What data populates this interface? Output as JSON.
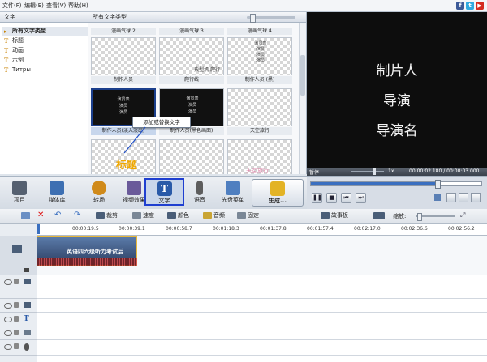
{
  "menu": [
    "文件(F)",
    "编辑(E)",
    "查看(V)",
    "帮助(H)"
  ],
  "social": [
    {
      "icon": "facebook-icon",
      "letter": "f",
      "color": "#3b5998"
    },
    {
      "icon": "twitter-icon",
      "letter": "t",
      "color": "#2fa9e0"
    },
    {
      "icon": "youtube-icon",
      "letter": "▶",
      "color": "#d42a1f"
    }
  ],
  "left_panel": {
    "title": "文字",
    "items": [
      {
        "label": "所有文字类型",
        "selected": true
      },
      {
        "label": "标题"
      },
      {
        "label": "动画"
      },
      {
        "label": "示例"
      },
      {
        "label": "Титры"
      }
    ]
  },
  "gallery": {
    "title": "所有文字类型",
    "top_row": [
      "漫画气球 2",
      "漫画气球 3",
      "漫画气球 4"
    ],
    "rows": [
      [
        {
          "caption": "制作人员",
          "art": ""
        },
        {
          "caption": "爬行线",
          "art": "典型机 爬行"
        },
        {
          "caption": "制作人员 (黑)",
          "art": "演员表\n演员\n演员\n演员"
        }
      ],
      [
        {
          "caption": "制作人员(淡入淡出)",
          "art": "演员表\n演员\n演员",
          "selected": true,
          "dark": true
        },
        {
          "caption": "制作人员(黑色画面)",
          "art": "演员表\n演员\n演员",
          "dark": true
        },
        {
          "caption": "天空旅行",
          "art": ""
        }
      ],
      [
        {
          "caption": "",
          "art": "标题",
          "art_color": "#f0a800"
        },
        {
          "caption": "",
          "art": ""
        },
        {
          "caption": "",
          "art": "天空旅行",
          "art_color": "#e08fb0"
        }
      ]
    ],
    "context_menu": "添加或替换文字"
  },
  "preview": {
    "lines": [
      "制片人",
      "导演",
      "导演名"
    ],
    "speed_label": "1x",
    "status_label": "暂停",
    "time": "00:00:02.180 / 00:00:03.000"
  },
  "toolbar": {
    "buttons": [
      {
        "label": "项目",
        "icon": "clapper-icon",
        "color": "#556070"
      },
      {
        "label": "媒体库",
        "icon": "film-icon",
        "color": "#3d6fb2"
      },
      {
        "label": "转场",
        "icon": "transition-icon",
        "color": "#d08a1a"
      },
      {
        "label": "视频效果",
        "icon": "fx-icon",
        "color": "#6a5a9a"
      },
      {
        "label": "文字",
        "icon": "text-icon",
        "color": "#2a5aa8",
        "active": true
      },
      {
        "label": "语音",
        "icon": "microphone-icon",
        "color": "#5d5d5d"
      },
      {
        "label": "光盘菜单",
        "icon": "disc-menu-icon",
        "color": "#4f7fc0"
      }
    ],
    "produce": "生成..."
  },
  "player": {
    "buttons": [
      {
        "icon": "pause-icon",
        "glyph": "❚❚"
      },
      {
        "icon": "stop-icon",
        "glyph": "■"
      },
      {
        "icon": "prev-frame-icon",
        "glyph": "⏮"
      },
      {
        "icon": "next-frame-icon",
        "glyph": "⏭"
      }
    ]
  },
  "timeline_toolbar": {
    "items": [
      {
        "label": "裁剪",
        "icon": "crop-icon"
      },
      {
        "label": "速度",
        "icon": "speed-icon"
      },
      {
        "label": "颜色",
        "icon": "color-icon"
      },
      {
        "label": "音频",
        "icon": "audio-icon"
      },
      {
        "label": "固定",
        "icon": "stabilize-icon"
      }
    ],
    "storyboard": "故事板",
    "zoom_label": "缩放:"
  },
  "ruler": [
    "00:00:19.5",
    "00:00:39.1",
    "00:00:58.7",
    "00:01:18.3",
    "00:01:37.8",
    "00:01:57.4",
    "00:02:17.0",
    "00:02:36.6",
    "00:02:56.2"
  ],
  "clip": {
    "title": "英语四六级听力考试后"
  }
}
